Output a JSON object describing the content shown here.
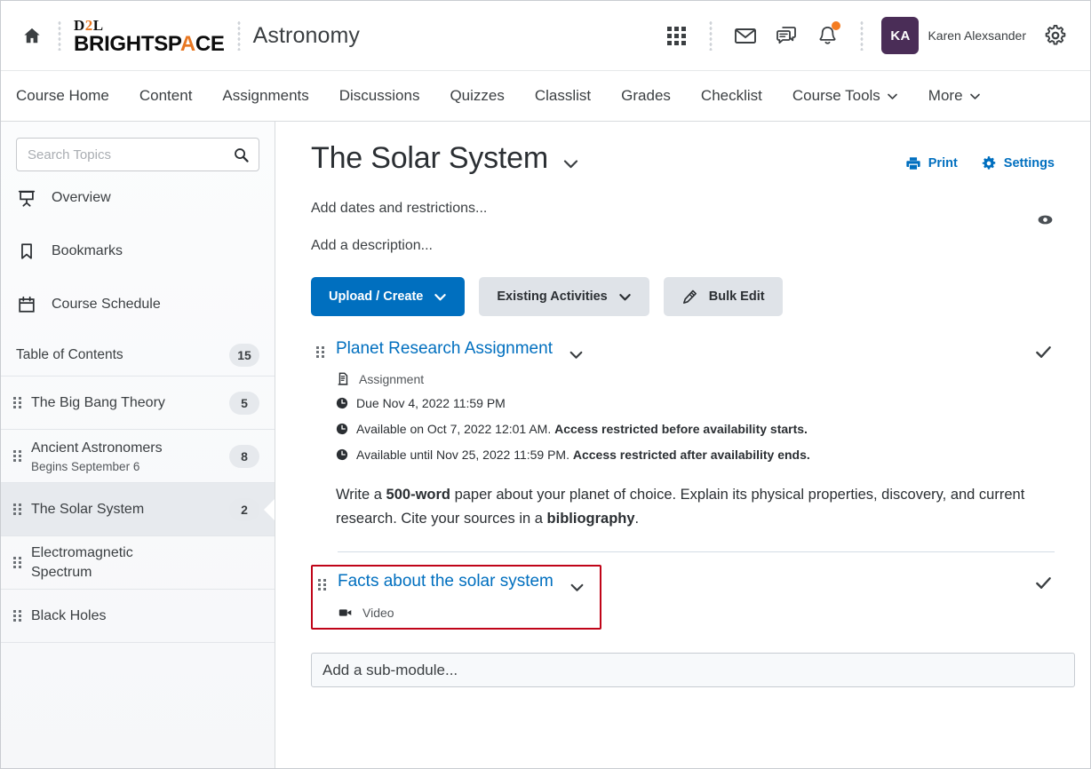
{
  "header": {
    "home_icon": "home-icon",
    "brand_d2l": "D2L",
    "brand_d2l_accent": "2",
    "brand_name_pre": "BRIGHTSP",
    "brand_name_accent": "A",
    "brand_name_post": "CE",
    "course_title": "Astronomy",
    "icons": [
      {
        "name": "waffle-icon",
        "label": "Course Selector"
      },
      {
        "name": "envelope-icon",
        "label": "Email"
      },
      {
        "name": "chat-icon",
        "label": "Messages"
      },
      {
        "name": "bell-icon",
        "label": "Notifications",
        "badge": true
      }
    ],
    "avatar_initials": "KA",
    "user_name": "Karen Alexsander",
    "settings_icon": "gear-icon"
  },
  "nav": {
    "items": [
      {
        "label": "Course Home",
        "caret": false
      },
      {
        "label": "Content",
        "caret": false
      },
      {
        "label": "Assignments",
        "caret": false
      },
      {
        "label": "Discussions",
        "caret": false
      },
      {
        "label": "Quizzes",
        "caret": false
      },
      {
        "label": "Classlist",
        "caret": false
      },
      {
        "label": "Grades",
        "caret": false
      },
      {
        "label": "Checklist",
        "caret": false
      },
      {
        "label": "Course Tools",
        "caret": true
      },
      {
        "label": "More",
        "caret": true
      }
    ]
  },
  "sidebar": {
    "search_placeholder": "Search Topics",
    "search_value": "",
    "links": [
      {
        "label": "Overview",
        "icon": "presentation-icon"
      },
      {
        "label": "Bookmarks",
        "icon": "bookmark-icon"
      },
      {
        "label": "Course Schedule",
        "icon": "calendar-icon"
      }
    ],
    "toc_label": "Table of Contents",
    "toc_count": "15",
    "modules": [
      {
        "title": "The Big Bang Theory",
        "sub": "",
        "count": "5",
        "selected": false
      },
      {
        "title": "Ancient Astronomers",
        "sub": "Begins September 6",
        "count": "8",
        "selected": false
      },
      {
        "title": "The Solar System",
        "sub": "",
        "count": "2",
        "selected": true
      },
      {
        "title": "Electromagnetic Spectrum",
        "sub": "",
        "count": "",
        "selected": false
      },
      {
        "title": "Black Holes",
        "sub": "",
        "count": "",
        "selected": false
      }
    ]
  },
  "main": {
    "page_title": "The Solar System",
    "title_caret_icon": "chevron-down-icon",
    "actions": [
      {
        "label": "Print",
        "icon": "printer-icon"
      },
      {
        "label": "Settings",
        "icon": "gear-icon"
      }
    ],
    "add_dates": "Add dates and restrictions...",
    "add_description": "Add a description...",
    "visibility_icon": "eye-icon",
    "buttons": [
      {
        "label": "Upload / Create",
        "style": "primary",
        "icon": "chevron-down-icon"
      },
      {
        "label": "Existing Activities",
        "style": "secondary",
        "icon": "chevron-down-icon"
      },
      {
        "label": "Bulk Edit",
        "style": "secondary",
        "icon": "pencil-icon"
      }
    ],
    "items": [
      {
        "title": "Planet Research Assignment",
        "type": "Assignment",
        "type_icon": "assignment-icon",
        "checked": true,
        "meta": [
          {
            "plain": "Due Nov 4, 2022 11:59 PM",
            "bold": ""
          },
          {
            "plain": "Available on Oct 7, 2022 12:01 AM. ",
            "bold": "Access restricted before availability starts."
          },
          {
            "plain": "Available until Nov 25, 2022 11:59 PM. ",
            "bold": "Access restricted after availability ends."
          }
        ]
      },
      {
        "title": "Facts about the solar system",
        "type": "Video",
        "type_icon": "video-icon",
        "checked": true,
        "highlighted": true,
        "highlight_color": "#c00418"
      }
    ],
    "description": {
      "p1": "Write a ",
      "b1": "500-word",
      "p2": " paper about your planet of choice. Explain its physical properties, discovery, and current research. Cite your sources in a ",
      "b2": "bibliography",
      "p3": "."
    },
    "sub_module_placeholder": "Add a sub-module..."
  },
  "colors": {
    "accent_blue": "#006fbf",
    "brand_orange": "#e87722",
    "avatar_purple": "#4a2d57",
    "highlight_red": "#c00418",
    "text_dark": "#2b2f33"
  }
}
